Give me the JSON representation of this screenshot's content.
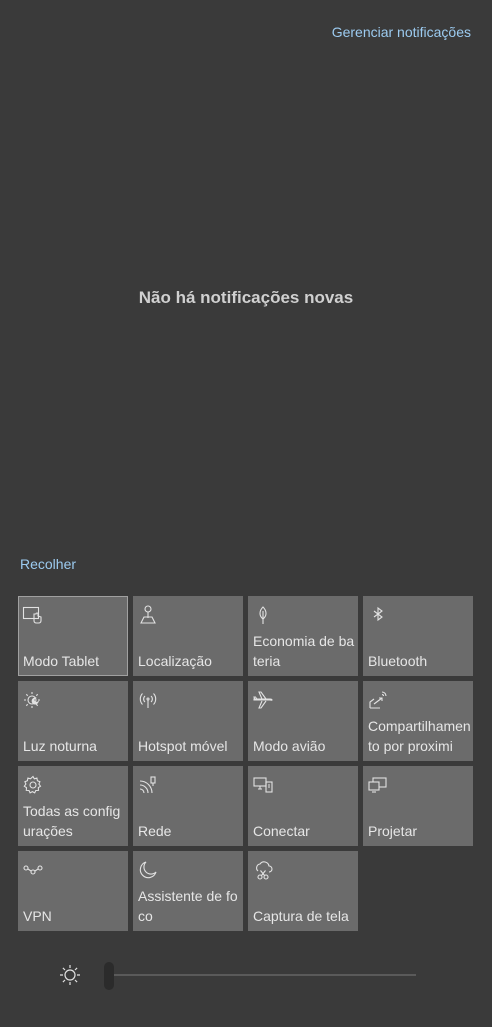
{
  "header": {
    "manage_label": "Gerenciar notificações"
  },
  "notifications": {
    "empty_message": "Não há notificações novas"
  },
  "quick_actions": {
    "collapse_label": "Recolher",
    "tiles": [
      {
        "label": "Modo Tablet",
        "icon": "tablet-mode-icon"
      },
      {
        "label": "Localização",
        "icon": "location-icon"
      },
      {
        "label": "Economia de bateria",
        "icon": "battery-saver-icon"
      },
      {
        "label": "Bluetooth",
        "icon": "bluetooth-icon"
      },
      {
        "label": "Luz noturna",
        "icon": "night-light-icon"
      },
      {
        "label": "Hotspot móvel",
        "icon": "mobile-hotspot-icon"
      },
      {
        "label": "Modo avião",
        "icon": "airplane-icon"
      },
      {
        "label": "Compartilhamento por proximi",
        "icon": "nearby-sharing-icon"
      },
      {
        "label": "Todas as configurações",
        "icon": "settings-gear-icon"
      },
      {
        "label": "Rede",
        "icon": "network-icon"
      },
      {
        "label": "Conectar",
        "icon": "connect-icon"
      },
      {
        "label": "Projetar",
        "icon": "project-icon"
      },
      {
        "label": "VPN",
        "icon": "vpn-icon"
      },
      {
        "label": "Assistente de foco",
        "icon": "focus-assist-moon-icon"
      },
      {
        "label": "Captura de tela",
        "icon": "screen-snip-icon"
      }
    ]
  },
  "brightness": {
    "level": 0.0,
    "icon": "brightness-sun-icon"
  },
  "colors": {
    "background": "#3a3a3a",
    "tile": "#6b6b6b",
    "link": "#9ccbf0"
  }
}
